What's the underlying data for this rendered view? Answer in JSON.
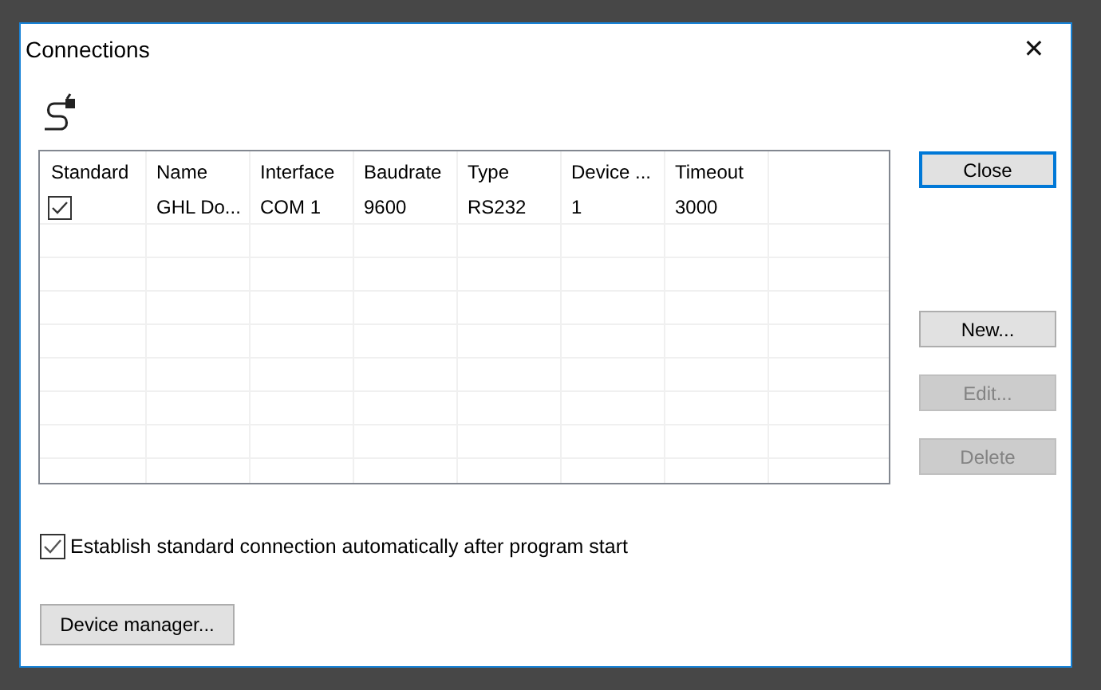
{
  "window": {
    "title": "Connections",
    "close_glyph": "✕"
  },
  "table": {
    "columns": [
      "Standard",
      "Name",
      "Interface",
      "Baudrate",
      "Type",
      "Device ...",
      "Timeout"
    ],
    "rows": [
      {
        "cells": [
          {
            "kind": "checkbox",
            "checked": true
          },
          {
            "kind": "text",
            "text": "GHL Do..."
          },
          {
            "kind": "text",
            "text": "COM 1"
          },
          {
            "kind": "text",
            "text": "9600"
          },
          {
            "kind": "text",
            "text": "RS232"
          },
          {
            "kind": "text",
            "text": "1"
          },
          {
            "kind": "text",
            "text": "3000"
          }
        ]
      }
    ]
  },
  "buttons": [
    {
      "label": "Close",
      "disabled": false,
      "focused": true
    },
    {
      "label": "New...",
      "disabled": false,
      "focused": false
    },
    {
      "label": "Edit...",
      "disabled": true,
      "focused": false
    },
    {
      "label": "Delete",
      "disabled": true,
      "focused": false
    }
  ],
  "auto_connect": {
    "label": "Establish standard connection automatically after program start",
    "checked": true
  },
  "device_manager": {
    "label": "Device manager..."
  }
}
